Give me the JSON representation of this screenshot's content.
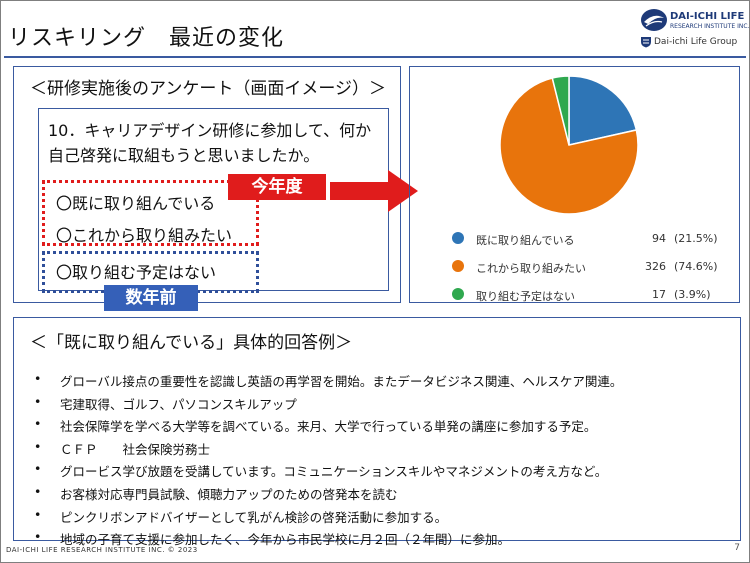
{
  "slide": {
    "title": "リスキリング　最近の変化",
    "logo": {
      "line1": "DAI-ICHI LIFE",
      "line2": "RESEARCH INSTITUTE INC.",
      "group": "Dai-ichi Life Group"
    },
    "footer": "DAI-ICHI LIFE RESEARCH INSTITUTE INC.  © 2023",
    "page_number": "7"
  },
  "survey": {
    "heading": "＜研修実施後のアンケート（画面イメージ）＞",
    "question": "10．キャリアデザイン研修に参加して、何か自己啓発に取組もうと思いましたか。",
    "options": [
      "〇既に取り組んでいる",
      "〇これから取り組みたい",
      "〇取り組む予定はない"
    ],
    "tag_this_year": "今年度",
    "tag_years_ago": "数年前"
  },
  "chart_data": {
    "type": "pie",
    "categories": [
      "既に取り組んでいる",
      "これから取り組みたい",
      "取り組む予定はない"
    ],
    "values": [
      94,
      326,
      17
    ],
    "percent_labels": [
      "(21.5%)",
      "(74.6%)",
      "(3.9%)"
    ],
    "colors": [
      "#2e75b6",
      "#e8740c",
      "#2fa84f"
    ]
  },
  "examples": {
    "heading": "＜「既に取り組んでいる」具体的回答例＞",
    "bullet": "•",
    "items": [
      "グローバル接点の重要性を認識し英語の再学習を開始。またデータビジネス関連、ヘルスケア関連。",
      "宅建取得、ゴルフ、パソコンスキルアップ",
      "社会保障学を学べる大学等を調べている。来月、大学で行っている単発の講座に参加する予定。",
      "ＣＦＰ　　社会保険労務士",
      "グロービス学び放題を受講しています。コミュニケーションスキルやマネジメントの考え方など。",
      "お客様対応専門員試験、傾聴力アップのための啓発本を読む",
      "ピンクリボンアドバイザーとして乳がん検診の啓発活動に参加する。",
      "地域の子育て支援に参加したく、今年から市民学校に月２回（２年間）に参加。"
    ]
  }
}
